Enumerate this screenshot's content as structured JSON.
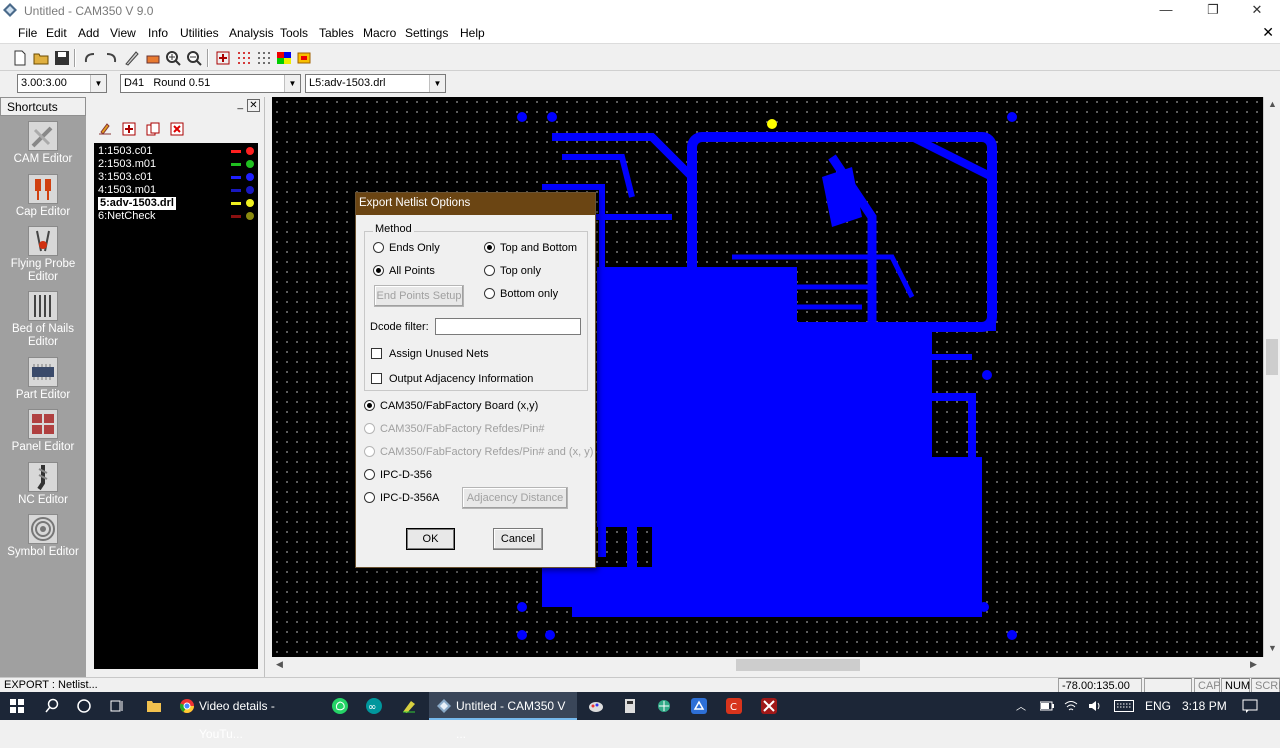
{
  "window": {
    "title": "Untitled - CAM350 V 9.0"
  },
  "menu": [
    "File",
    "Edit",
    "Add",
    "View",
    "Info",
    "Utilities",
    "Analysis",
    "Tools",
    "Tables",
    "Macro",
    "Settings",
    "Help"
  ],
  "combos": {
    "grid": "3.00:3.00",
    "dcode": "D41   Round 0.51",
    "layer": "L5:adv-1503.drl"
  },
  "shortcuts": {
    "header": "Shortcuts",
    "items": [
      "CAM Editor",
      "Cap Editor",
      "Flying Probe Editor",
      "Bed of Nails Editor",
      "Part Editor",
      "Panel Editor",
      "NC Editor",
      "Symbol Editor"
    ]
  },
  "layers": [
    {
      "label": "1:1503.c01",
      "color": "#ff2020"
    },
    {
      "label": "2:1503.m01",
      "color": "#20c020"
    },
    {
      "label": "3:1503.c01",
      "color": "#2020ff"
    },
    {
      "label": "4:1503.m01",
      "color": "#1818c0"
    },
    {
      "label": "5:adv-1503.drl",
      "color": "#f0f020"
    },
    {
      "label": "6:NetCheck",
      "color": "#8a8a10"
    }
  ],
  "dialog": {
    "title": "Export Netlist Options",
    "method_label": "Method",
    "ends_only": "Ends Only",
    "all_points": "All Points",
    "top_bottom": "Top and Bottom",
    "top_only": "Top only",
    "bottom_only": "Bottom only",
    "end_points_setup": "End Points Setup",
    "dcode_filter": "Dcode filter:",
    "assign_unused": "Assign Unused Nets",
    "output_adjacency": "Output Adjacency Information",
    "formats": [
      "CAM350/FabFactory Board (x,y)",
      "CAM350/FabFactory Refdes/Pin#",
      "CAM350/FabFactory Refdes/Pin# and (x, y)",
      "IPC-D-356",
      "IPC-D-356A"
    ],
    "adjacency_distance": "Adjacency Distance",
    "ok": "OK",
    "cancel": "Cancel"
  },
  "status": {
    "text": "EXPORT : Netlist...",
    "coords": "-78.00:135.00",
    "cap": "CAP",
    "num": "NUM",
    "scrl": "SCRL"
  },
  "taskbar": {
    "video": "Video details - YouTu...",
    "cam": "Untitled - CAM350 V ...",
    "lang": "ENG",
    "time": "3:18 PM"
  },
  "colors": {
    "trace": "#0000ff",
    "dialog_title": "#6b4513",
    "taskbar": "#1c2637"
  }
}
